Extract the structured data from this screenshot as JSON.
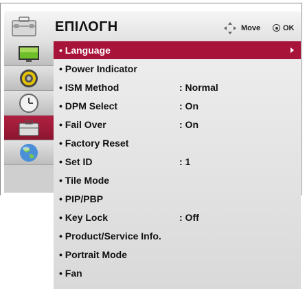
{
  "header": {
    "title": "ΕΠΙΛΟΓΗ",
    "move_label": "Move",
    "ok_label": "OK",
    "icon": "toolbox-icon"
  },
  "sidebar": {
    "items": [
      {
        "icon": "picture-monitor-icon",
        "active": false
      },
      {
        "icon": "speaker-sound-icon",
        "active": false
      },
      {
        "icon": "clock-time-icon",
        "active": false
      },
      {
        "icon": "toolbox-option-icon",
        "active": true
      },
      {
        "icon": "globe-network-icon",
        "active": false
      }
    ]
  },
  "menu": {
    "items": [
      {
        "label": "• Language",
        "value": "",
        "selected": true,
        "has_submenu": true
      },
      {
        "label": "• Power Indicator",
        "value": ""
      },
      {
        "label": "• ISM Method",
        "value": ": Normal"
      },
      {
        "label": "• DPM Select",
        "value": ": On"
      },
      {
        "label": "• Fail Over",
        "value": ": On"
      },
      {
        "label": "• Factory Reset",
        "value": ""
      },
      {
        "label": "• Set ID",
        "value": ": 1"
      },
      {
        "label": "• Tile Mode",
        "value": ""
      },
      {
        "label": "• PIP/PBP",
        "value": ""
      },
      {
        "label": "• Key Lock",
        "value": ": Off"
      },
      {
        "label": "• Product/Service Info.",
        "value": ""
      },
      {
        "label": "• Portrait Mode",
        "value": ""
      },
      {
        "label": "• Fan",
        "value": ""
      }
    ]
  },
  "colors": {
    "selected": "#a8133a",
    "panel": "#e6e6e6",
    "sidebar_active": "#9c1a36"
  }
}
